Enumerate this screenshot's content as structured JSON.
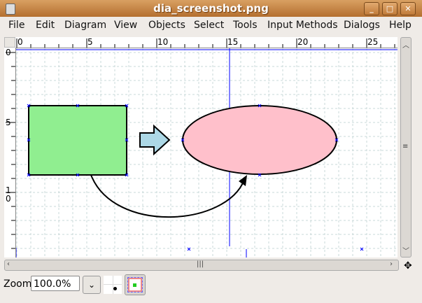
{
  "window": {
    "title": "dia_screenshot.png",
    "minimize": "_",
    "maximize": "□",
    "close": "✕"
  },
  "menu": [
    "File",
    "Edit",
    "Diagram",
    "View",
    "Objects",
    "Select",
    "Tools",
    "Input Methods",
    "Dialogs",
    "Help"
  ],
  "rulers": {
    "horizontal": [
      "0",
      "5",
      "10",
      "15",
      "20",
      "25"
    ],
    "vertical": [
      "0",
      "5",
      "1\n0"
    ]
  },
  "diagram": {
    "rect_color": "#90ee90",
    "arrow_color": "#add8e6",
    "ellipse_color": "#ffc0cb",
    "guide_color": "#0000ff"
  },
  "zoom": {
    "label": "Zoom",
    "value": "100.0%"
  },
  "icons": {
    "move": "move-icon"
  }
}
